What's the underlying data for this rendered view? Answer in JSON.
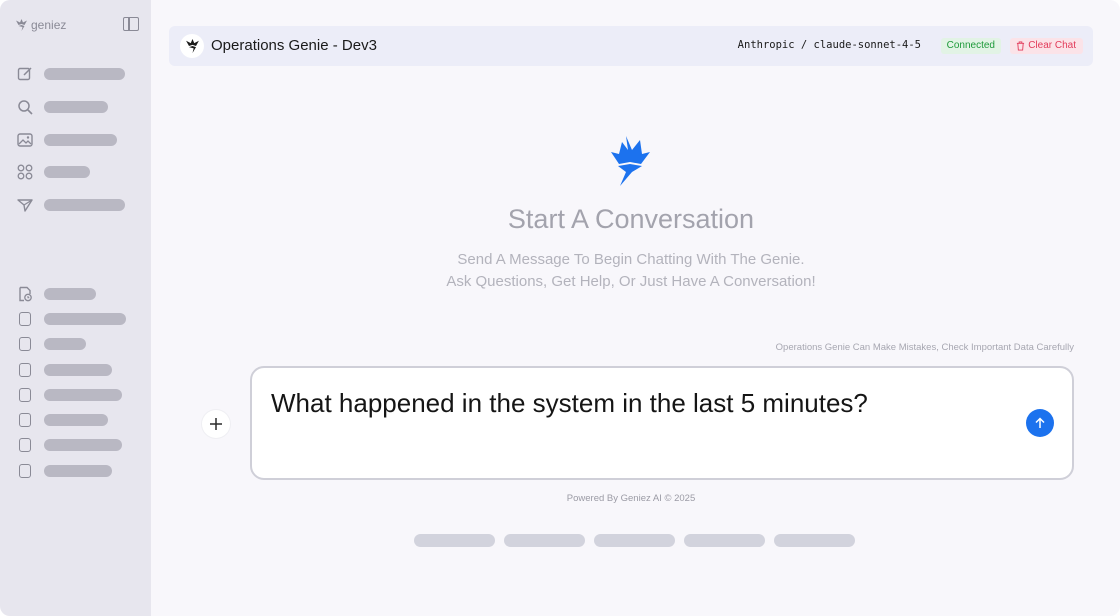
{
  "sidebar": {
    "brand": "geniez",
    "collapse_icon": "sidebar-toggle-icon",
    "nav_icons": [
      "edit-icon",
      "search-icon",
      "image-icon",
      "apps-icon",
      "send-icon"
    ],
    "history_icons": [
      "document-clock-icon",
      "document-icon",
      "document-icon",
      "document-icon",
      "document-icon",
      "document-icon",
      "document-icon",
      "document-icon"
    ]
  },
  "header": {
    "title": "Operations Genie - Dev3",
    "model": "Anthropic / claude-sonnet-4-5",
    "status": "Connected",
    "clear_label": "Clear Chat"
  },
  "hero": {
    "title": "Start A Conversation",
    "subtitle_line1": "Send A Message To Begin Chatting With The Genie.",
    "subtitle_line2": "Ask Questions, Get Help, Or Just Have A Conversation!"
  },
  "disclaimer": "Operations Genie Can Make Mistakes, Check Important Data Carefully",
  "composer": {
    "value": "What happened in the system in the last 5 minutes?"
  },
  "footer": "Powered By Geniez AI © 2025",
  "colors": {
    "accent": "#1c72ee",
    "connected": "#1e9a3a",
    "clear": "#e23b5a"
  }
}
